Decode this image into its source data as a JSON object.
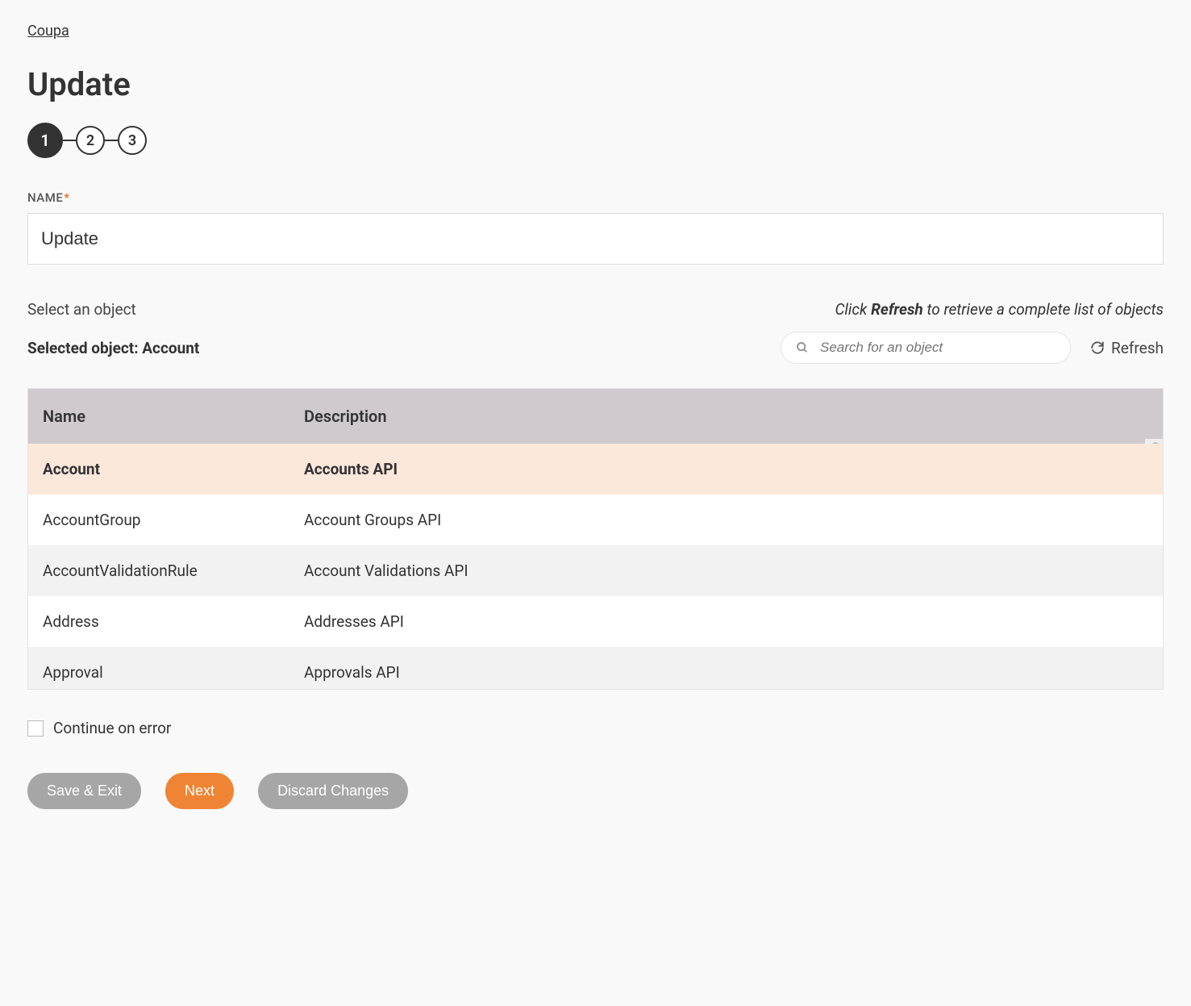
{
  "breadcrumb": "Coupa",
  "page_title": "Update",
  "stepper": {
    "steps": [
      "1",
      "2",
      "3"
    ],
    "active_index": 0
  },
  "name_field": {
    "label": "NAME",
    "required": "*",
    "value": "Update"
  },
  "object_section": {
    "prompt": "Select an object",
    "refresh_hint_prefix": "Click ",
    "refresh_hint_bold": "Refresh",
    "refresh_hint_suffix": " to retrieve a complete list of objects",
    "selected_prefix": "Selected object: ",
    "selected_value": "Account",
    "search_placeholder": "Search for an object",
    "refresh_label": "Refresh"
  },
  "table": {
    "headers": {
      "name": "Name",
      "description": "Description"
    },
    "rows": [
      {
        "name": "Account",
        "description": "Accounts API",
        "selected": true
      },
      {
        "name": "AccountGroup",
        "description": "Account Groups API",
        "selected": false
      },
      {
        "name": "AccountValidationRule",
        "description": "Account Validations API",
        "selected": false
      },
      {
        "name": "Address",
        "description": "Addresses API",
        "selected": false
      },
      {
        "name": "Approval",
        "description": "Approvals API",
        "selected": false
      }
    ]
  },
  "continue_on_error_label": "Continue on error",
  "buttons": {
    "save_exit": "Save & Exit",
    "next": "Next",
    "discard": "Discard Changes"
  }
}
